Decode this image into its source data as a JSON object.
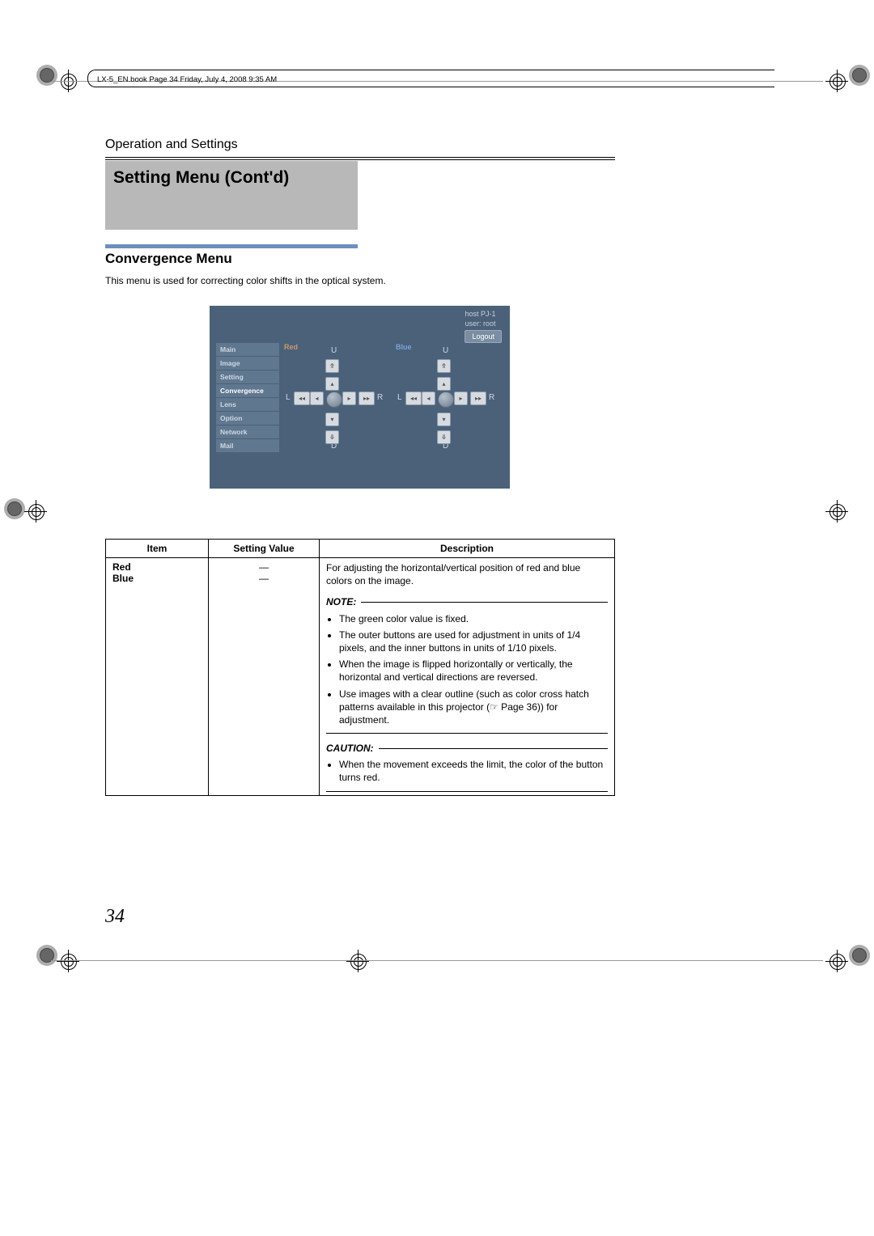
{
  "book_header": "LX-5_EN.book  Page 34  Friday, July 4, 2008  9:35 AM",
  "chapter": "Operation and Settings",
  "page_title": "Setting Menu (Cont'd)",
  "section_title": "Convergence Menu",
  "section_desc": "This menu is used for correcting color shifts in the optical system.",
  "page_number": "34",
  "ui": {
    "host_line": "host PJ-1",
    "user_line": "user: root",
    "logout": "Logout",
    "menu": [
      "Main",
      "Image",
      "Setting",
      "Convergence",
      "Lens",
      "Option",
      "Network",
      "Mail"
    ],
    "active_menu_index": 3,
    "panels": {
      "red": {
        "title": "Red",
        "U": "U",
        "D": "D",
        "L": "L",
        "R": "R"
      },
      "blue": {
        "title": "Blue",
        "U": "U",
        "D": "D",
        "L": "L",
        "R": "R"
      }
    }
  },
  "table": {
    "headers": {
      "item": "Item",
      "value": "Setting Value",
      "desc": "Description"
    },
    "row": {
      "item1": "Red",
      "item2": "Blue",
      "value1": "—",
      "value2": "—",
      "desc_main": "For adjusting the horizontal/vertical position of red and blue colors on the image.",
      "note_label": "NOTE:",
      "notes": [
        "The green color value is fixed.",
        "The outer buttons are used for adjustment in units of 1/4 pixels, and the inner buttons in units of 1/10 pixels.",
        "When the image is flipped horizontally or vertically, the horizontal and vertical directions are reversed.",
        "Use images with a clear outline (such as color cross hatch patterns available in this projector (☞ Page 36)) for adjustment."
      ],
      "caution_label": "CAUTION:",
      "cautions": [
        "When the movement exceeds the limit, the color of the button turns red."
      ]
    }
  }
}
